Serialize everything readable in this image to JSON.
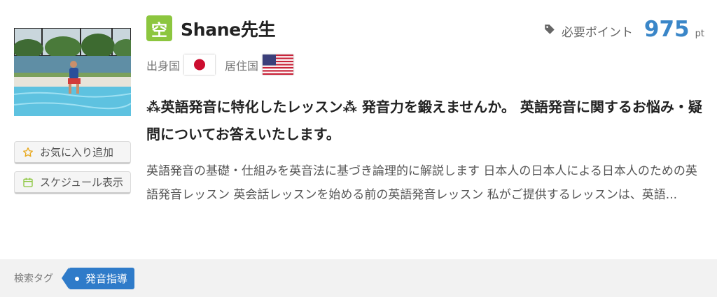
{
  "teacher": {
    "status_badge": "空",
    "name": "Shane先生",
    "photo_alt": "teacher photo"
  },
  "points": {
    "label": "必要ポイント",
    "value": "975",
    "unit": "pt",
    "icon": "tag-icon"
  },
  "countries": {
    "origin_label": "出身国",
    "origin_flag": "japan-flag",
    "residence_label": "居住国",
    "residence_flag": "usa-flag"
  },
  "headline": "⁂英語発音に特化したレッスン⁂ 発音力を鍛えませんか。 英語発音に関するお悩み・疑問についてお答えいたします。",
  "description": "英語発音の基礎・仕組みを英音法に基づき論理的に解説します 日本人の日本人による日本人のための英語発音レッスン 英会話レッスンを始める前の英語発音レッスン 私がご提供するレッスンは、英語...",
  "actions": {
    "favorite_label": "お気に入り追加",
    "favorite_icon": "star-icon",
    "schedule_label": "スケジュール表示",
    "schedule_icon": "calendar-icon"
  },
  "tags": {
    "label": "検索タグ",
    "items": [
      "発音指導"
    ]
  },
  "colors": {
    "accent_blue": "#3a86c8",
    "badge_green": "#8cc63f",
    "tag_blue": "#2f7bc9"
  }
}
